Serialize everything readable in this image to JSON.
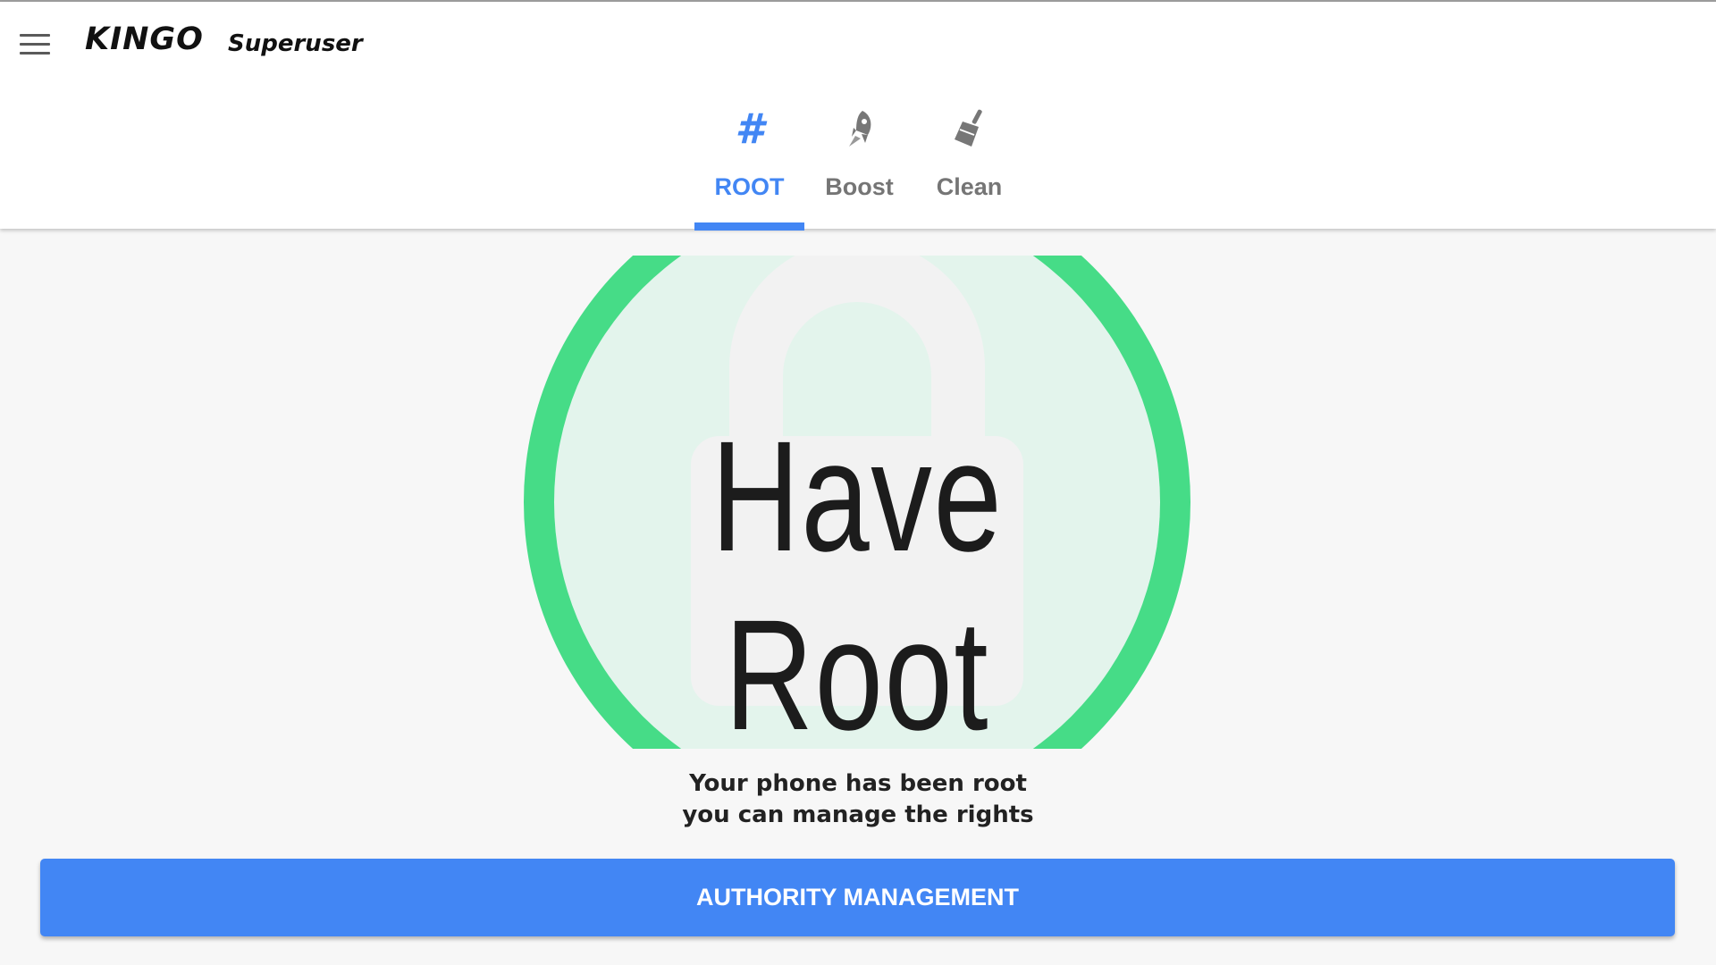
{
  "app": {
    "brand": "KINGO",
    "title": "Superuser"
  },
  "header": {
    "menu_icon": "hamburger-menu-icon"
  },
  "tabs": [
    {
      "label": "ROOT",
      "icon": "hash-icon",
      "active": true
    },
    {
      "label": "Boost",
      "icon": "rocket-icon",
      "active": false
    },
    {
      "label": "Clean",
      "icon": "broom-icon",
      "active": false
    }
  ],
  "status": {
    "headline": "Have Root",
    "icon": "unlocked-padlock-icon",
    "message_line1": "Your phone has been root",
    "message_line2": "you can manage the rights"
  },
  "actions": {
    "primary_label": "AUTHORITY MANAGEMENT"
  },
  "colors": {
    "accent": "#4286f4",
    "ring": "#46dc87",
    "ring_inner": "#e3f4ec",
    "inactive_tab": "#757575"
  }
}
